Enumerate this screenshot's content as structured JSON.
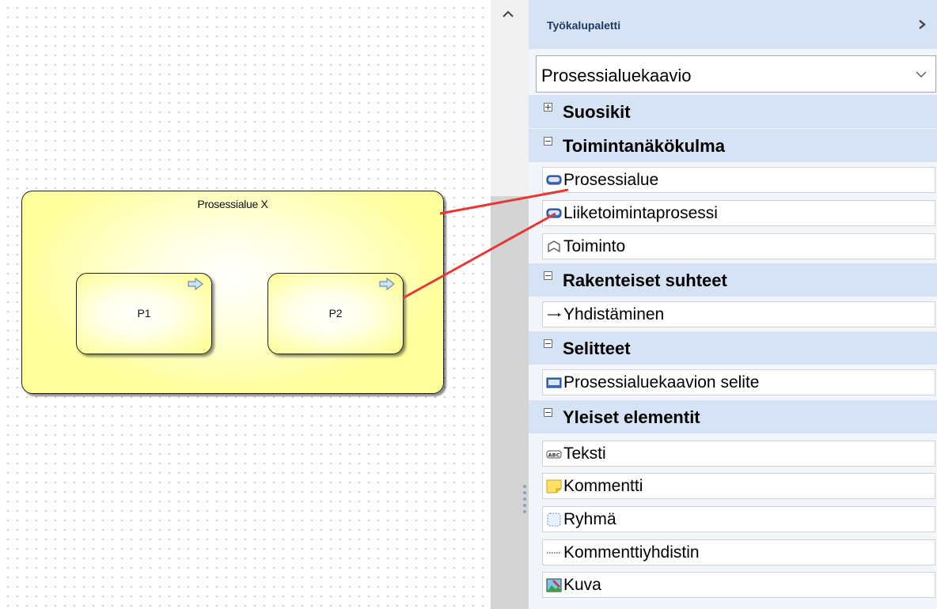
{
  "canvas": {
    "area_title": "Prosessialue X",
    "processes": [
      {
        "label": "P1"
      },
      {
        "label": "P2"
      }
    ]
  },
  "palette": {
    "title": "Työkalupaletti",
    "dropdown_value": "Prosessialuekaavio",
    "sections": [
      {
        "label": "Suosikit",
        "state": "collapsed",
        "items": []
      },
      {
        "label": "Toimintanäkökulma",
        "state": "expanded",
        "items": [
          {
            "label": "Prosessialue",
            "icon": "process-area-icon"
          },
          {
            "label": "Liiketoimintaprosessi",
            "icon": "business-process-icon"
          },
          {
            "label": "Toiminto",
            "icon": "function-icon"
          }
        ]
      },
      {
        "label": "Rakenteiset suhteet",
        "state": "expanded",
        "items": [
          {
            "label": "Yhdistäminen",
            "icon": "arrow-connector-icon"
          }
        ]
      },
      {
        "label": "Selitteet",
        "state": "expanded",
        "items": [
          {
            "label": "Prosessialuekaavion selite",
            "icon": "legend-icon"
          }
        ]
      },
      {
        "label": "Yleiset elementit",
        "state": "expanded",
        "items": [
          {
            "label": "Teksti",
            "icon": "text-icon"
          },
          {
            "label": "Kommentti",
            "icon": "comment-icon"
          },
          {
            "label": "Ryhmä",
            "icon": "group-icon"
          },
          {
            "label": "Kommenttiyhdistin",
            "icon": "comment-connector-icon"
          },
          {
            "label": "Kuva",
            "icon": "image-icon"
          }
        ]
      }
    ]
  },
  "colors": {
    "area_fill": "#ffff9a",
    "palette_header": "#d6e3f4",
    "annotation_line": "#e53935",
    "title_text": "#1f3864"
  }
}
